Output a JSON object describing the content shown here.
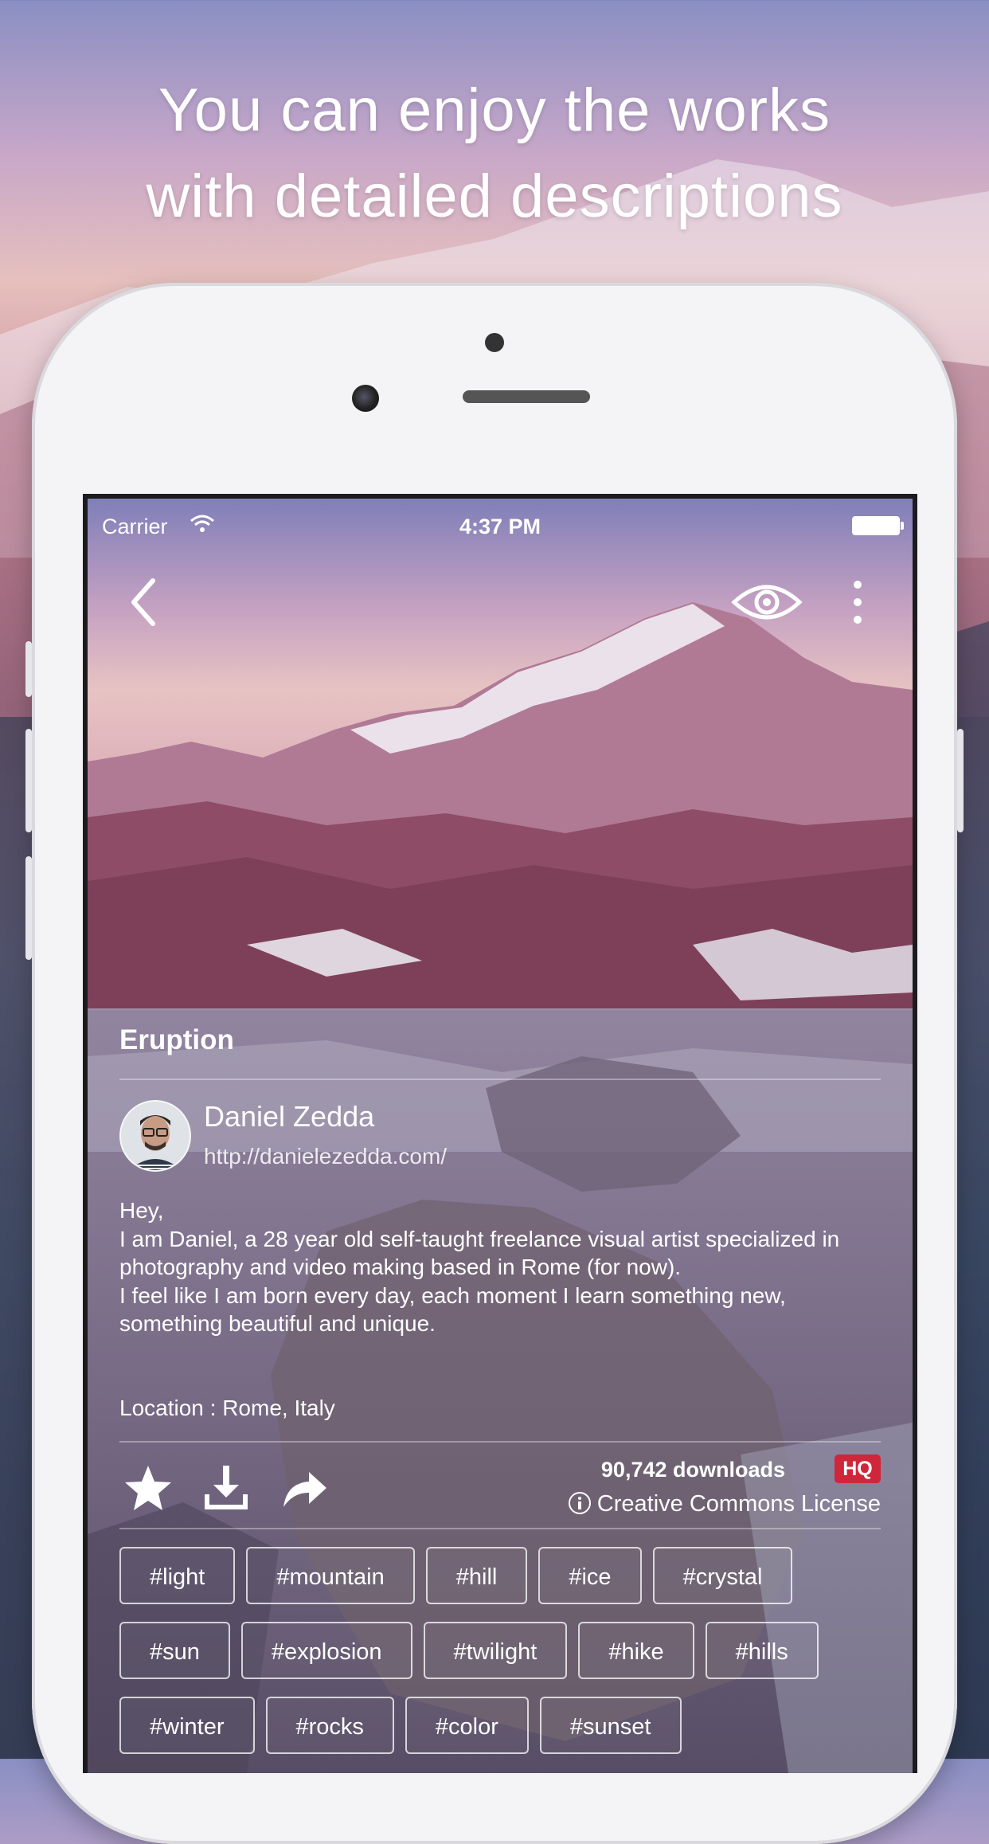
{
  "headline": {
    "line1": "You can enjoy the works",
    "line2": "with detailed descriptions"
  },
  "status_bar": {
    "carrier": "Carrier",
    "time": "4:37 PM"
  },
  "nav": {
    "back_icon": "chevron-left-icon",
    "eye_icon": "eye-icon",
    "more_icon": "more-vertical-icon"
  },
  "photo": {
    "title": "Eruption",
    "author": {
      "name": "Daniel Zedda",
      "url": "http://danielezedda.com/"
    },
    "description": [
      "Hey,",
      "I am Daniel, a 28 year old self-taught freelance visual artist specialized in photography and video making based in Rome (for now).",
      "I feel like I am born every day, each moment I learn something new, something beautiful and unique."
    ],
    "location": "Location : Rome, Italy",
    "downloads": "90,742 downloads",
    "quality_badge": "HQ",
    "license": "Creative Commons License",
    "tags": [
      [
        "#light",
        "#mountain",
        "#hill",
        "#ice",
        "#crystal"
      ],
      [
        "#sun",
        "#explosion",
        "#twilight",
        "#hike",
        "#hills"
      ],
      [
        "#winter",
        "#rocks",
        "#color",
        "#sunset"
      ]
    ]
  },
  "actions": {
    "favorite_icon": "star-icon",
    "download_icon": "download-icon",
    "share_icon": "share-arrow-icon"
  },
  "colors": {
    "hq_badge": "#d0263a",
    "text": "#ffffff"
  }
}
